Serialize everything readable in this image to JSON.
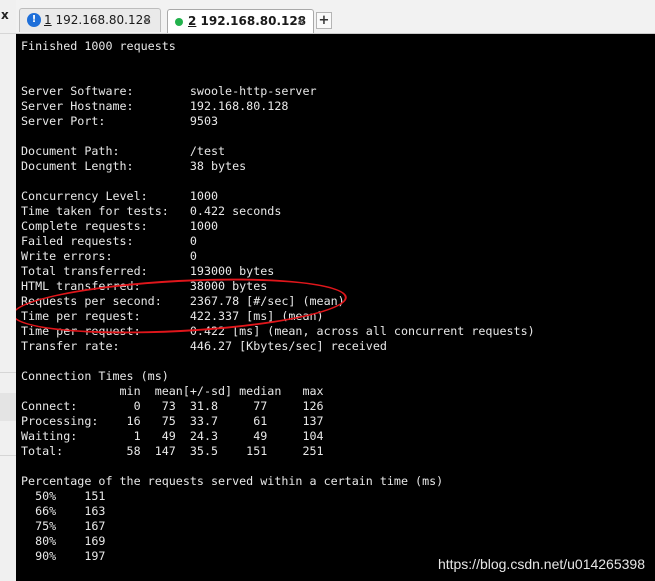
{
  "left_panel": {
    "close_glyph": "x"
  },
  "tabs": [
    {
      "number": "1",
      "title": "192.168.80.128",
      "status_icon": "warning-icon",
      "active": false,
      "close_glyph": "×"
    },
    {
      "number": "2",
      "title": "192.168.80.128",
      "status_icon": "green-status-dot-icon",
      "active": true,
      "close_glyph": "×"
    }
  ],
  "new_tab_glyph": "+",
  "terminal": {
    "lines": [
      "Finished 1000 requests",
      "",
      "",
      "Server Software:        swoole-http-server",
      "Server Hostname:        192.168.80.128",
      "Server Port:            9503",
      "",
      "Document Path:          /test",
      "Document Length:        38 bytes",
      "",
      "Concurrency Level:      1000",
      "Time taken for tests:   0.422 seconds",
      "Complete requests:      1000",
      "Failed requests:        0",
      "Write errors:           0",
      "Total transferred:      193000 bytes",
      "HTML transferred:       38000 bytes",
      "Requests per second:    2367.78 [#/sec] (mean)",
      "Time per request:       422.337 [ms] (mean)",
      "Time per request:       0.422 [ms] (mean, across all concurrent requests)",
      "Transfer rate:          446.27 [Kbytes/sec] received",
      "",
      "Connection Times (ms)",
      "              min  mean[+/-sd] median   max",
      "Connect:        0   73  31.8     77     126",
      "Processing:    16   75  33.7     61     137",
      "Waiting:        1   49  24.3     49     104",
      "Total:         58  147  35.5    151     251",
      "",
      "Percentage of the requests served within a certain time (ms)",
      "  50%    151",
      "  66%    163",
      "  75%    167",
      "  80%    169",
      "  90%    197"
    ],
    "annotation_color": "#e0161b",
    "background": "#000000",
    "foreground": "#e8e8e8"
  },
  "watermark": "https://blog.csdn.net/u014265398"
}
